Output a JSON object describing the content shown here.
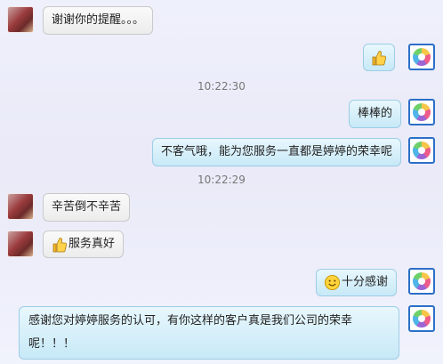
{
  "timestamps": [
    "10:22:30",
    "10:22:29"
  ],
  "messages": [
    {
      "sender": "user",
      "text": "谢谢你的提醒。。。"
    },
    {
      "sender": "service",
      "text": "",
      "icon": "thumbs-up-icon"
    },
    {
      "sender": "service",
      "text": "棒棒的"
    },
    {
      "sender": "service",
      "text": "不客气哦，能为您服务一直都是婷婷的荣幸呢"
    },
    {
      "sender": "user",
      "text": "辛苦倒不辛苦"
    },
    {
      "sender": "user",
      "text": "服务真好",
      "icon": "thumbs-up-icon"
    },
    {
      "sender": "service",
      "text": "十分感谢",
      "icon": "smiley-icon"
    },
    {
      "sender": "service",
      "text_line1": "感谢您对婷婷服务的认可，有你这样的客户真是我们公司的荣幸",
      "text_line2": "呢！！！"
    }
  ],
  "colors": {
    "background": "#eceef9",
    "service_bubble": "#d2eefa",
    "user_bubble": "#f1f1f1",
    "service_avatar_border": "#2c6fc7"
  }
}
